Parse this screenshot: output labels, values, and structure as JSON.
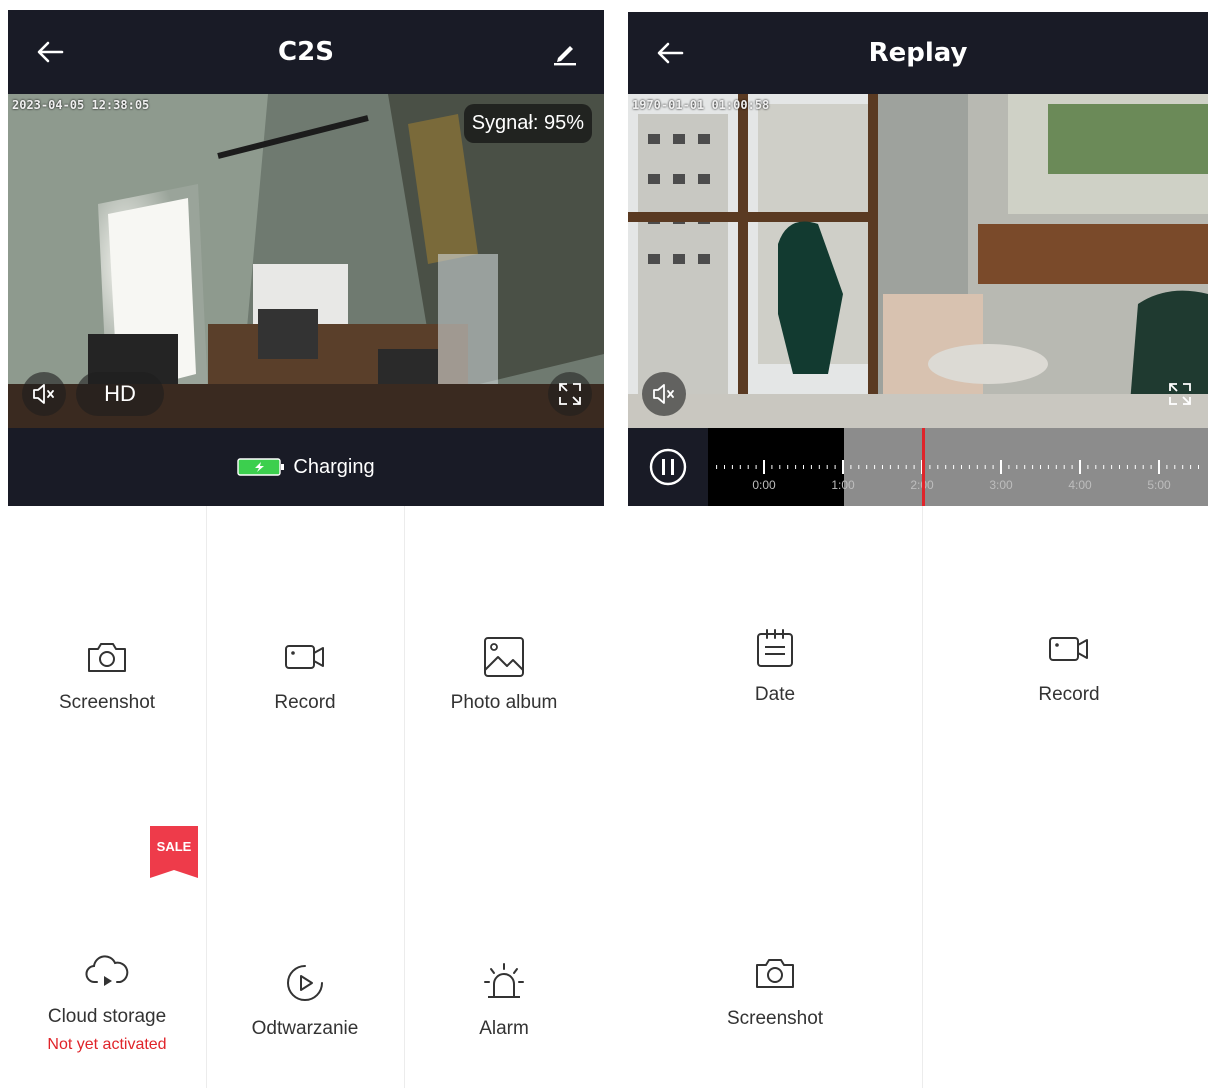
{
  "left_screen": {
    "header": {
      "title": "C2S"
    },
    "video": {
      "timestamp": "2023-04-05 12:38:05",
      "signal_text": "Sygnał: 95%",
      "quality_label": "HD"
    },
    "status": {
      "charging_text": "Charging"
    },
    "actions": [
      {
        "label": "Screenshot",
        "icon": "camera-icon"
      },
      {
        "label": "Record",
        "icon": "video-camera-icon"
      },
      {
        "label": "Photo album",
        "icon": "photo-icon"
      },
      {
        "label": "Cloud storage",
        "sub": "Not yet activated",
        "icon": "cloud-play-icon",
        "badge": "SALE"
      },
      {
        "label": "Odtwarzanie",
        "icon": "playback-icon"
      },
      {
        "label": "Alarm",
        "icon": "siren-icon"
      }
    ]
  },
  "right_screen": {
    "header": {
      "title": "Replay"
    },
    "video": {
      "timestamp": "1970-01-01 01:00:58"
    },
    "timeline": {
      "ticks": [
        "0:00",
        "1:00",
        "2:00",
        "3:00",
        "4:00",
        "5:00"
      ]
    },
    "actions": [
      {
        "label": "Date",
        "icon": "calendar-icon"
      },
      {
        "label": "Record",
        "icon": "video-camera-icon"
      },
      {
        "label": "Screenshot",
        "icon": "camera-icon"
      }
    ]
  },
  "colors": {
    "bar": "#191b26",
    "accent_red": "#e0242a",
    "battery_green": "#3ccf4e"
  }
}
